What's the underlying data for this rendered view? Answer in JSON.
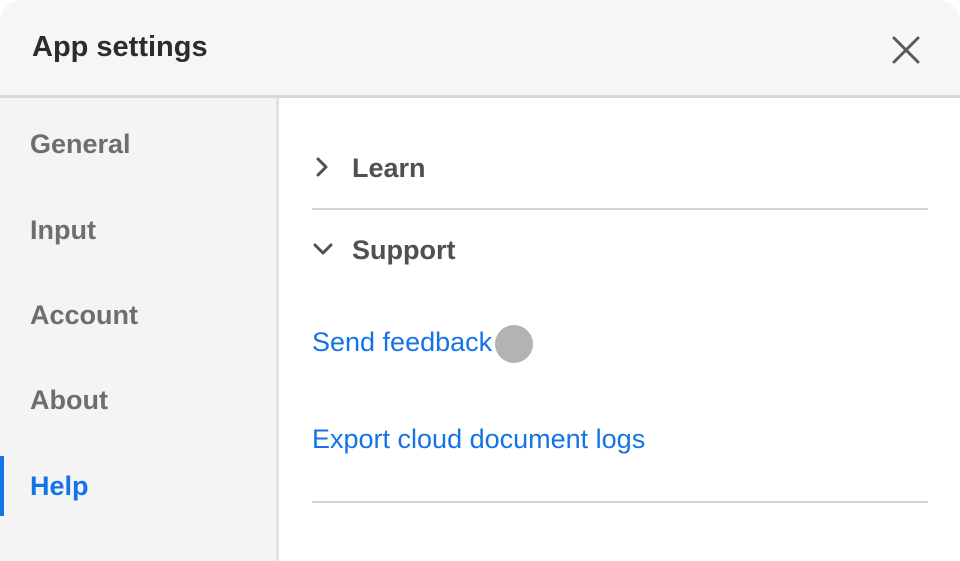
{
  "dialog": {
    "title": "App settings",
    "close_icon": "close-icon"
  },
  "sidebar": {
    "items": [
      {
        "label": "General",
        "active": false
      },
      {
        "label": "Input",
        "active": false
      },
      {
        "label": "Account",
        "active": false
      },
      {
        "label": "About",
        "active": false
      },
      {
        "label": "Help",
        "active": true
      }
    ]
  },
  "help": {
    "sections": [
      {
        "label": "Learn",
        "expanded": false,
        "icon": "chevron-right-icon"
      },
      {
        "label": "Support",
        "expanded": true,
        "icon": "chevron-down-icon"
      }
    ],
    "support_links": [
      {
        "label": "Send feedback"
      },
      {
        "label": "Export cloud document logs"
      }
    ]
  },
  "colors": {
    "accent": "#1473e6",
    "header_bg": "#f6f6f6",
    "sidebar_bg": "#f4f4f4",
    "text_muted": "#6e6e6e"
  }
}
